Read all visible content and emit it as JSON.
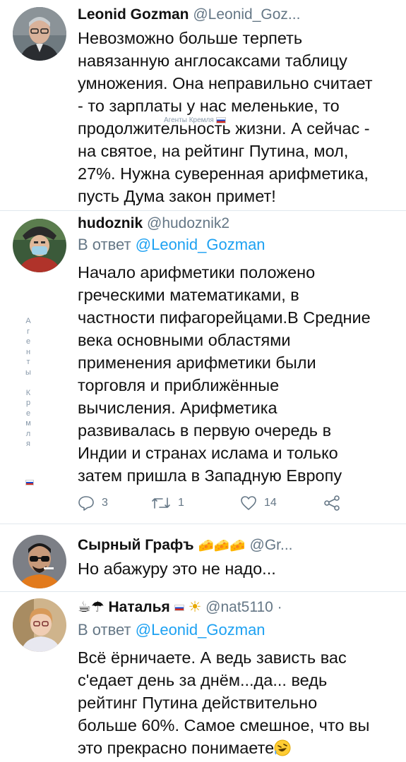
{
  "watermark": {
    "inline_text": "Агенты Кремля",
    "vertical_letters": [
      "А",
      "г",
      "е",
      "н",
      "т",
      "ы",
      "",
      "К",
      "р",
      "е",
      "м",
      "л",
      "я"
    ]
  },
  "tweets": [
    {
      "name": "Leonid Gozman",
      "handle": "@Leonid_Goz...",
      "lines": [
        "Невозможно больше терпеть",
        "навязанную англосаксами таблицу",
        "умножения. Она неправильно считает",
        "- то зарплаты у нас меленькие, то",
        "продолжительность жизни. А сейчас -",
        "на святое, на рейтинг Путина, мол,",
        "27%. Нужна суверенная арифметика,",
        "пусть Дума закон примет!"
      ]
    },
    {
      "name": "hudoznik",
      "handle": "@hudoznik2",
      "reply_prefix": "В ответ",
      "reply_mention": "@Leonid_Gozman",
      "lines": [
        "Начало арифметики положено",
        "греческими математиками, в",
        "частности пифагорейцами.В Средние",
        "века основными областями",
        "применения арифметики были",
        "торговля и приближённые",
        "вычисления. Арифметика",
        "развивалась в первую очередь в",
        "Индии и странах ислама и только",
        "затем пришла в Западную Европу"
      ],
      "actions": {
        "reply_count": "3",
        "retweet_count": "1",
        "like_count": "14",
        "reply_icon": "reply-icon",
        "retweet_icon": "retweet-icon",
        "like_icon": "heart-icon",
        "share_icon": "share-icon"
      }
    },
    {
      "name": "Сырный Графъ",
      "name_emoji": "🧀🧀🧀",
      "handle": "@Gr...",
      "lines": [
        "Но абажуру это не надо..."
      ]
    },
    {
      "name_prefix_emoji": "☕☂",
      "name": "Наталья",
      "name_suffix_emoji": "☀",
      "handle": "@nat5110 ·",
      "reply_prefix": "В ответ",
      "reply_mention": "@Leonid_Gozman",
      "lines": [
        "Всё ёрничаете. А ведь зависть вас",
        "с'едает день за днём...да... ведь",
        "рейтинг Путина действительно",
        "больше 60%. Самое смешное, что вы",
        "это прекрасно понимаете"
      ],
      "end_emoji": "rolling-laughing-emoji"
    }
  ],
  "colors": {
    "handle": "#657786",
    "mention": "#1da1f2",
    "divider": "#e1e8ed"
  }
}
